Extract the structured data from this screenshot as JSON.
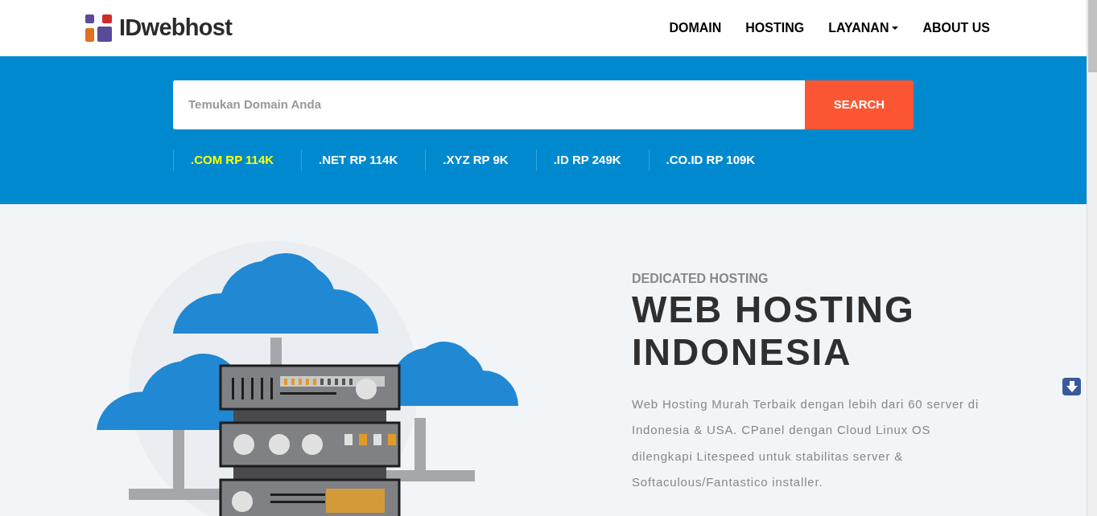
{
  "header": {
    "logo": "IDwebhost",
    "nav": [
      {
        "label": "DOMAIN",
        "dropdown": false
      },
      {
        "label": "HOSTING",
        "dropdown": false
      },
      {
        "label": "LAYANAN",
        "dropdown": true
      },
      {
        "label": "ABOUT US",
        "dropdown": false
      }
    ]
  },
  "domain_search": {
    "placeholder": "Temukan Domain Anda",
    "button": "SEARCH"
  },
  "prices": [
    {
      "label": ".COM RP 114K",
      "selected": true
    },
    {
      "label": ".NET RP 114K",
      "selected": false
    },
    {
      "label": ".XYZ RP 9K",
      "selected": false
    },
    {
      "label": ".ID RP 249K",
      "selected": false
    },
    {
      "label": ".CO.ID RP 109K",
      "selected": false
    }
  ],
  "hero": {
    "eyebrow": "DEDICATED HOSTING",
    "title_lines": [
      "WEB HOSTING",
      "INDONESIA"
    ],
    "description": "Web Hosting Murah Terbaik dengan lebih dari 60 server di Indonesia & USA. CPanel dengan Cloud Linux OS dilengkapi Litespeed untuk stabilitas server & Softaculous/Fantastico installer."
  }
}
